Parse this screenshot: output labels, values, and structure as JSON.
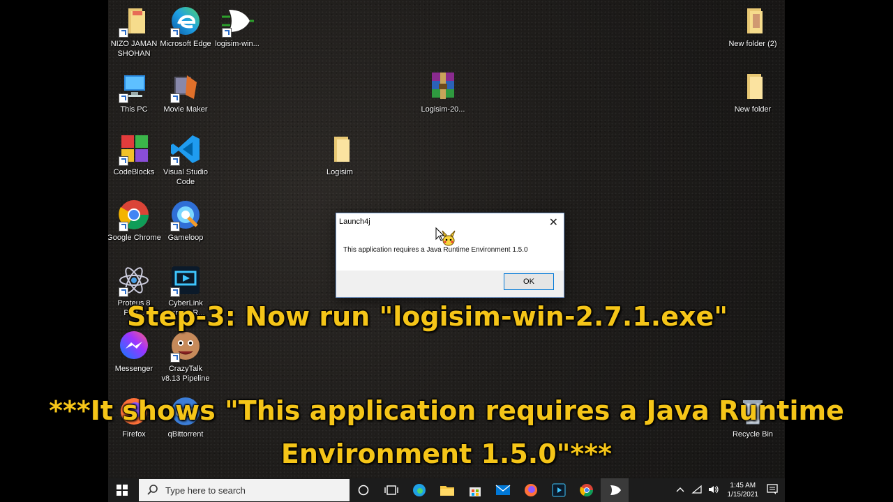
{
  "desktop": {
    "icons": [
      {
        "label": "NIZO JAMAN SHOHAN",
        "icon": "folder-icon"
      },
      {
        "label": "Microsoft Edge",
        "icon": "edge-icon"
      },
      {
        "label": "logisim-win...",
        "icon": "logisim-icon"
      },
      {
        "label": "This PC",
        "icon": "pc-icon"
      },
      {
        "label": "Movie Maker",
        "icon": "movie-maker-icon"
      },
      {
        "label": "CodeBlocks",
        "icon": "codeblocks-icon"
      },
      {
        "label": "Visual Studio Code",
        "icon": "vscode-icon"
      },
      {
        "label": "Google Chrome",
        "icon": "chrome-icon"
      },
      {
        "label": "Gameloop",
        "icon": "gameloop-icon"
      },
      {
        "label": "Proteus 8 Prof...",
        "icon": "proteus-icon"
      },
      {
        "label": "CyberLink Screen R...",
        "icon": "cyberlink-icon"
      },
      {
        "label": "Messenger",
        "icon": "messenger-icon"
      },
      {
        "label": "CrazyTalk v8.13 Pipeline",
        "icon": "crazytalk-icon"
      },
      {
        "label": "Firefox",
        "icon": "firefox-icon"
      },
      {
        "label": "qBittorrent",
        "icon": "qbittorrent-icon"
      },
      {
        "label": "Logisim-20...",
        "icon": "winrar-icon"
      },
      {
        "label": "Logisim",
        "icon": "folder-icon"
      },
      {
        "label": "New folder (2)",
        "icon": "folder-icon"
      },
      {
        "label": "New folder",
        "icon": "folder-icon"
      },
      {
        "label": "Recycle Bin",
        "icon": "recycle-bin-icon"
      }
    ]
  },
  "dialog": {
    "title": "Launch4j",
    "message": "This application requires a Java Runtime Environment 1.5.0",
    "ok_label": "OK",
    "close_label": "✕"
  },
  "captions": {
    "step": "Step-3: Now run \"logisim-win-2.7.1.exe\"",
    "note": "***It shows \"This application requires a Java Runtime Environment 1.5.0\"***"
  },
  "taskbar": {
    "search_placeholder": "Type here to search",
    "time": "1:45 AM",
    "date": "1/15/2021",
    "apps": [
      "cortana-icon",
      "task-view-icon",
      "edge-icon",
      "file-explorer-icon",
      "store-icon",
      "mail-icon",
      "firefox-icon",
      "cyberlink-icon",
      "chrome-icon",
      "logisim-icon"
    ]
  },
  "colors": {
    "caption": "#f5c518",
    "taskbar": "#1c1c1c",
    "accent": "#0078d7"
  }
}
